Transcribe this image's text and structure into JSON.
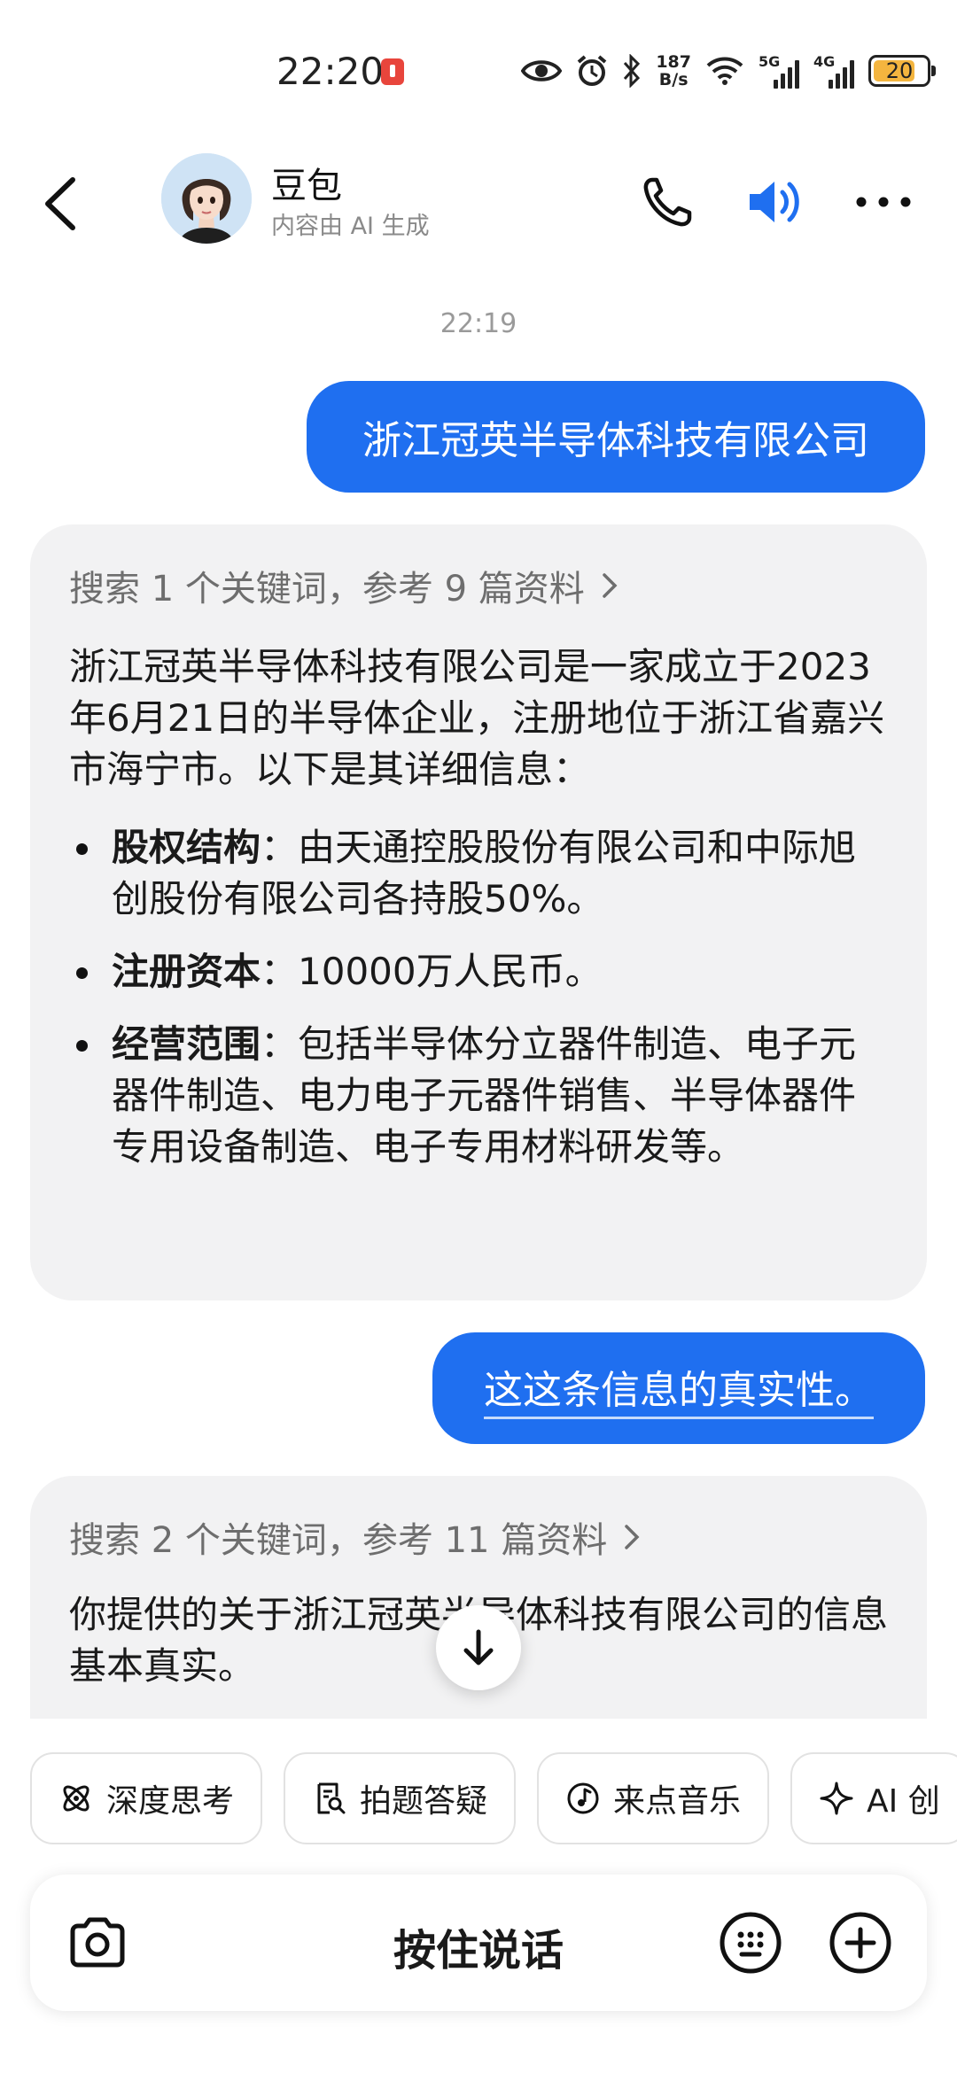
{
  "status_bar": {
    "time": "22:20",
    "net_speed_value": "187",
    "net_speed_unit": "B/s",
    "signal1_label": "5G",
    "signal2_label": "4G",
    "battery": "20",
    "battery_color": "#f4b53f"
  },
  "header": {
    "name": "豆包",
    "subtitle": "内容由 AI 生成"
  },
  "chat": {
    "timestamp": "22:19",
    "user_msg_1": "浙江冠英半导体科技有限公司",
    "bot_1": {
      "search_summary": "搜索 1 个关键词，参考 9 篇资料",
      "intro": "浙江冠英半导体科技有限公司是一家成立于2023年6月21日的半导体企业，注册地位于浙江省嘉兴市海宁市。以下是其详细信息：",
      "bullets": [
        {
          "term": "股权结构",
          "text": "：由天通控股股份有限公司和中际旭创股份有限公司各持股50%。"
        },
        {
          "term": "注册资本",
          "text": "：10000万人民币。"
        },
        {
          "term": "经营范围",
          "text": "：包括半导体分立器件制造、电子元器件制造、电力电子元器件销售、半导体器件专用设备制造、电子专用材料研发等。"
        }
      ]
    },
    "user_msg_2": "这这条信息的真实性。",
    "bot_2": {
      "search_summary": "搜索 2 个关键词，参考 11 篇资料",
      "text": "你提供的关于浙江冠英半导体科技有限公司的信息基本真实。"
    }
  },
  "chips": [
    {
      "label": "深度思考",
      "icon": "atom-icon"
    },
    {
      "label": "拍题答疑",
      "icon": "doc-search-icon"
    },
    {
      "label": "来点音乐",
      "icon": "music-icon"
    },
    {
      "label": "AI 创",
      "icon": "sparkle-icon"
    }
  ],
  "input_bar": {
    "hold_to_talk": "按住说话"
  },
  "colors": {
    "accent": "#1f6ff0",
    "bot_bubble": "#f2f2f3"
  }
}
